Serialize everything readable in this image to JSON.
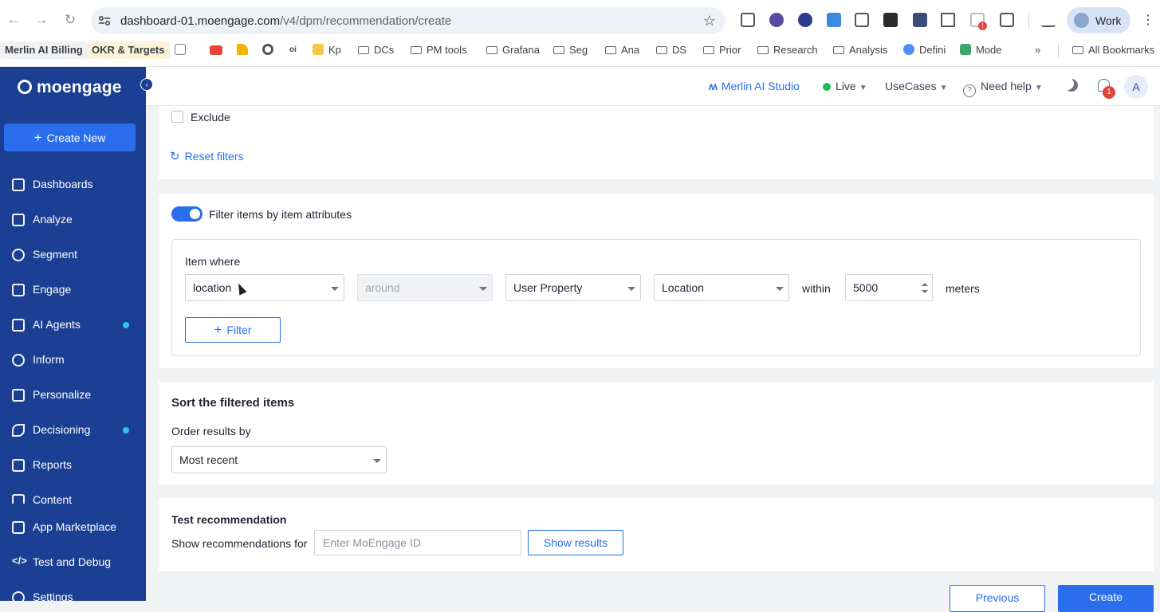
{
  "browser": {
    "url_host": "dashboard-01.moengage.com",
    "url_path": "/v4/dpm/recommendation/create",
    "profile_label": "Work",
    "bookmarks": [
      "Merlin AI Billing",
      "OKR & Targets",
      "Kp",
      "DCs",
      "PM tools",
      "Grafana",
      "Seg",
      "Ana",
      "DS",
      "Prior",
      "Research",
      "Analysis",
      "Defini",
      "Mode",
      "All Bookmarks"
    ],
    "bookmark_extra": "oi",
    "more": "»",
    "ext_badge": "!"
  },
  "sidebar": {
    "brand": "moengage",
    "create_label": "Create New",
    "items": [
      {
        "label": "Dashboards",
        "dot": false
      },
      {
        "label": "Analyze",
        "dot": false
      },
      {
        "label": "Segment",
        "dot": false
      },
      {
        "label": "Engage",
        "dot": false
      },
      {
        "label": "AI Agents",
        "dot": true
      },
      {
        "label": "Inform",
        "dot": false
      },
      {
        "label": "Personalize",
        "dot": false
      },
      {
        "label": "Decisioning",
        "dot": true
      },
      {
        "label": "Reports",
        "dot": false
      },
      {
        "label": "Content",
        "dot": false
      },
      {
        "label": "App Marketplace",
        "dot": false
      },
      {
        "label": "Test and Debug",
        "dot": false
      },
      {
        "label": "Settings",
        "dot": false
      }
    ],
    "dot_color": "#29c6e5"
  },
  "header": {
    "merlin": "Merlin AI Studio",
    "env": "Live",
    "usecases": "UseCases",
    "help": "Need help",
    "notif_count": "1",
    "avatar": "A"
  },
  "exclude": {
    "label": "Exclude"
  },
  "reset": {
    "label": "Reset filters"
  },
  "item_filter": {
    "toggle_label": "Filter items by item attributes",
    "enabled": true,
    "where_label": "Item where",
    "attribute": "location",
    "operator": "around",
    "source": "User Property",
    "property": "Location",
    "within_label": "within",
    "distance": "5000",
    "unit": "meters",
    "add_filter": "Filter"
  },
  "sort": {
    "title": "Sort the filtered items",
    "order_label": "Order results by",
    "order_value": "Most recent"
  },
  "test": {
    "title": "Test recommendation",
    "show_for": "Show recommendations for",
    "placeholder": "Enter MoEngage ID",
    "show_results": "Show results"
  },
  "footer": {
    "previous": "Previous",
    "create": "Create"
  },
  "colors": {
    "sidebar": "#1b3f93",
    "accent": "#2a6ded",
    "live": "#1db954",
    "badge": "#e0443e"
  }
}
